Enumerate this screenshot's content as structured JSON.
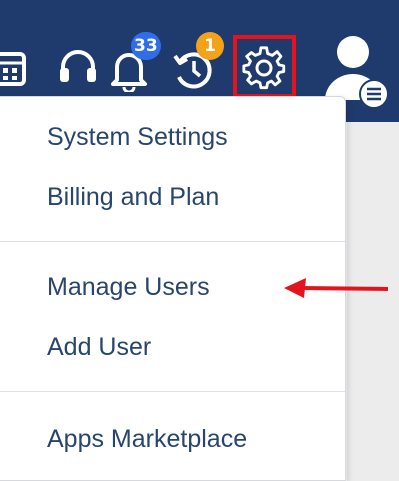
{
  "header": {
    "icons": {
      "calendar": "calendar-icon",
      "headset": "headset-icon",
      "notifications": "bell-icon",
      "tasks": "clock-refresh-icon",
      "settings": "gear-icon",
      "user": "user-avatar-icon"
    },
    "notifications_count": "33",
    "tasks_count": "1"
  },
  "menu": {
    "section1": [
      "System Settings",
      "Billing and Plan"
    ],
    "section2": [
      "Manage Users",
      "Add User"
    ],
    "section3": [
      "Apps Marketplace"
    ]
  },
  "colors": {
    "header_bg": "#1f3a6d",
    "menu_text": "#27456f",
    "badge_blue": "#2f6ee8",
    "badge_orange": "#f5a21b",
    "annotation_red": "#e3141d"
  }
}
